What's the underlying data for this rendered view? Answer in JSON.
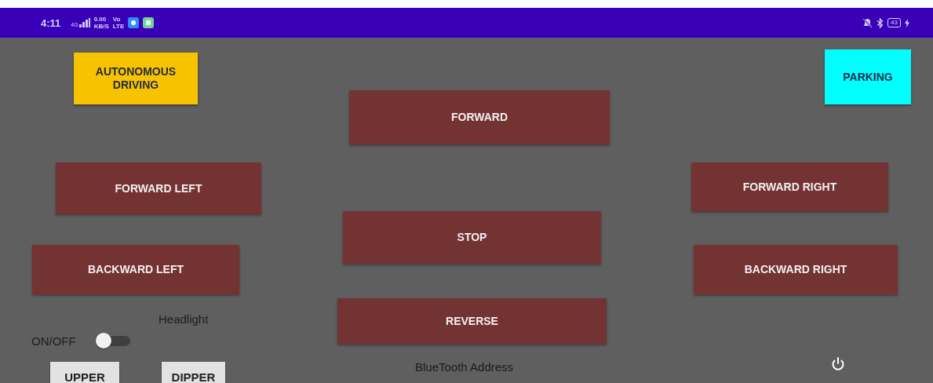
{
  "status_bar": {
    "time": "4:11",
    "network": "4G",
    "data_rate": "0.00",
    "data_unit": "KB/S",
    "volte_top": "Vo",
    "volte_bottom": "LTE",
    "battery": "43",
    "charging": true
  },
  "controls": [
    {
      "label": "AUTONOMOUS DRIVING",
      "color": "#f7c200"
    },
    {
      "label": "PARKING",
      "color": "#00ffff"
    },
    {
      "label": "FORWARD",
      "color": "#733333"
    },
    {
      "label": "FORWARD LEFT",
      "color": "#733333"
    },
    {
      "label": "FORWARD RIGHT",
      "color": "#733333"
    },
    {
      "label": "STOP",
      "color": "#733333"
    },
    {
      "label": "BACKWARD LEFT",
      "color": "#733333"
    },
    {
      "label": "BACKWARD RIGHT",
      "color": "#733333"
    },
    {
      "label": "REVERSE",
      "color": "#733333"
    }
  ],
  "headlight": {
    "title": "Headlight",
    "toggle_label": "ON/OFF",
    "on": false,
    "buttons": [
      "UPPER",
      "DIPPER"
    ]
  },
  "bluetooth_address": "BlueTooth Address"
}
